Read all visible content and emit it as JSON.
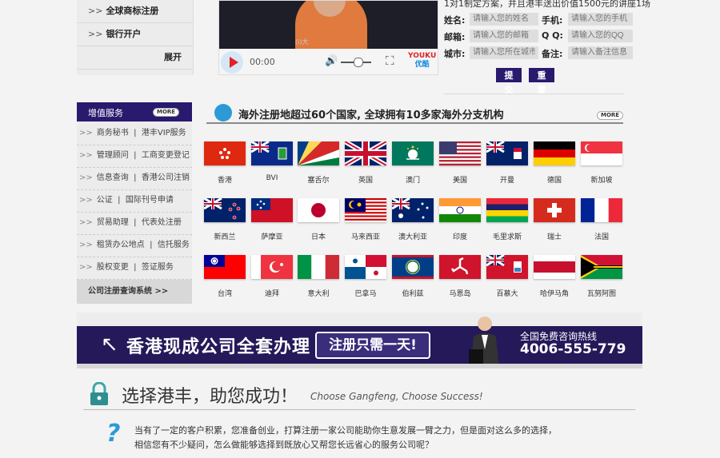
{
  "top_menu": {
    "items": [
      "全球商标注册",
      "银行开户"
    ],
    "expand_label": "展开"
  },
  "video": {
    "caption": "(i)大",
    "time": "00:00",
    "logo_top": "YOUKU",
    "logo_bottom": "优酷"
  },
  "form": {
    "note": "1对1制定方案，并且港丰送出价值1500元的讲座1场",
    "fields": [
      {
        "label": "姓名:",
        "placeholder": "请输入您的姓名"
      },
      {
        "label": "手机:",
        "placeholder": "请输入您的手机"
      },
      {
        "label": "邮箱:",
        "placeholder": "请输入您的邮箱"
      },
      {
        "label": "Q Q:",
        "placeholder": "请输入您的QQ"
      },
      {
        "label": "城市:",
        "placeholder": "请输入您所在城市"
      },
      {
        "label": "备注:",
        "placeholder": "请输入备注信息"
      }
    ],
    "submit_label": "提交",
    "reset_label": "重置"
  },
  "services": {
    "title": "增值服务",
    "more": "MORE",
    "rows": [
      [
        "商务秘书",
        "港丰VIP服务"
      ],
      [
        "管理顾问",
        "工商变更登记"
      ],
      [
        "信息查询",
        "香港公司注销"
      ],
      [
        "公证",
        "国际刊号申请"
      ],
      [
        "贸易助理",
        "代表处注册"
      ],
      [
        "租赁办公地点",
        "信托服务"
      ],
      [
        "股权变更",
        "签证服务"
      ]
    ],
    "query_label": "公司注册查询系统 >>"
  },
  "overseas": {
    "title": "海外注册地超过60个国家, 全球拥有10多家海外分支机构",
    "more": "MORE",
    "flags": [
      {
        "name": "香港",
        "icon": "hong-kong-flag"
      },
      {
        "name": "BVI",
        "icon": "bvi-flag"
      },
      {
        "name": "塞舌尔",
        "icon": "seychelles-flag"
      },
      {
        "name": "英国",
        "icon": "uk-flag"
      },
      {
        "name": "澳门",
        "icon": "macau-flag"
      },
      {
        "name": "美国",
        "icon": "usa-flag"
      },
      {
        "name": "开曼",
        "icon": "cayman-flag"
      },
      {
        "name": "德国",
        "icon": "germany-flag"
      },
      {
        "name": "新加坡",
        "icon": "singapore-flag"
      },
      {
        "name": "新西兰",
        "icon": "new-zealand-flag"
      },
      {
        "name": "萨摩亚",
        "icon": "samoa-flag"
      },
      {
        "name": "日本",
        "icon": "japan-flag"
      },
      {
        "name": "马来西亚",
        "icon": "malaysia-flag"
      },
      {
        "name": "澳大利亚",
        "icon": "australia-flag"
      },
      {
        "name": "印度",
        "icon": "india-flag"
      },
      {
        "name": "毛里求斯",
        "icon": "mauritius-flag"
      },
      {
        "name": "瑞士",
        "icon": "switzerland-flag"
      },
      {
        "name": "法国",
        "icon": "france-flag"
      },
      {
        "name": "台湾",
        "icon": "taiwan-flag"
      },
      {
        "name": "迪拜",
        "icon": "dubai-flag"
      },
      {
        "name": "意大利",
        "icon": "italy-flag"
      },
      {
        "name": "巴拿马",
        "icon": "panama-flag"
      },
      {
        "name": "伯利兹",
        "icon": "belize-flag"
      },
      {
        "name": "马恩岛",
        "icon": "isle-of-man-flag"
      },
      {
        "name": "百慕大",
        "icon": "bermuda-flag"
      },
      {
        "name": "哈伊马角",
        "icon": "ras-al-khaimah-flag"
      },
      {
        "name": "瓦努阿图",
        "icon": "vanuatu-flag"
      }
    ]
  },
  "banner": {
    "main": "香港现成公司全套办理",
    "pill": "注册只需一天!",
    "hotline_label": "全国免费咨询热线",
    "hotline": "4006-555-779"
  },
  "choose": {
    "title": "选择港丰，助您成功！",
    "subtitle": "Choose Gangfeng, Choose Success!",
    "line1": "当有了一定的客户积累，您准备创业，打算注册一家公司能助你生意发展一臂之力，但是面对这么多的选择，",
    "line2": "相信您有不少疑问，怎么做能够选择到既放心又帮您长远省心的服务公司呢？"
  },
  "colors": {
    "brand": "#2a1a6e",
    "accent": "#2b9ad6",
    "play": "#e02222"
  }
}
